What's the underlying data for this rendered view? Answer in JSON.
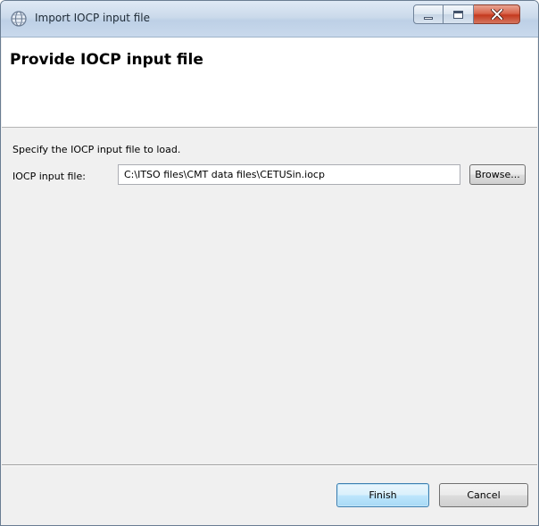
{
  "window": {
    "title": "Import IOCP input file",
    "app_icon": "globe-icon",
    "controls": {
      "minimize_icon": "minimize-icon",
      "maximize_icon": "maximize-icon",
      "close_icon": "close-icon"
    }
  },
  "header": {
    "title": "Provide IOCP input file"
  },
  "main": {
    "instruction": "Specify the IOCP input file to load.",
    "file_field": {
      "label": "IOCP input file:",
      "value": "C:\\ITSO files\\CMT data files\\CETUSin.iocp"
    },
    "browse_label": "Browse..."
  },
  "footer": {
    "finish_label": "Finish",
    "cancel_label": "Cancel"
  },
  "colors": {
    "close_button": "#c43a1f",
    "default_button": "#3c7fb1",
    "dialog_background": "#f0f0f0"
  }
}
